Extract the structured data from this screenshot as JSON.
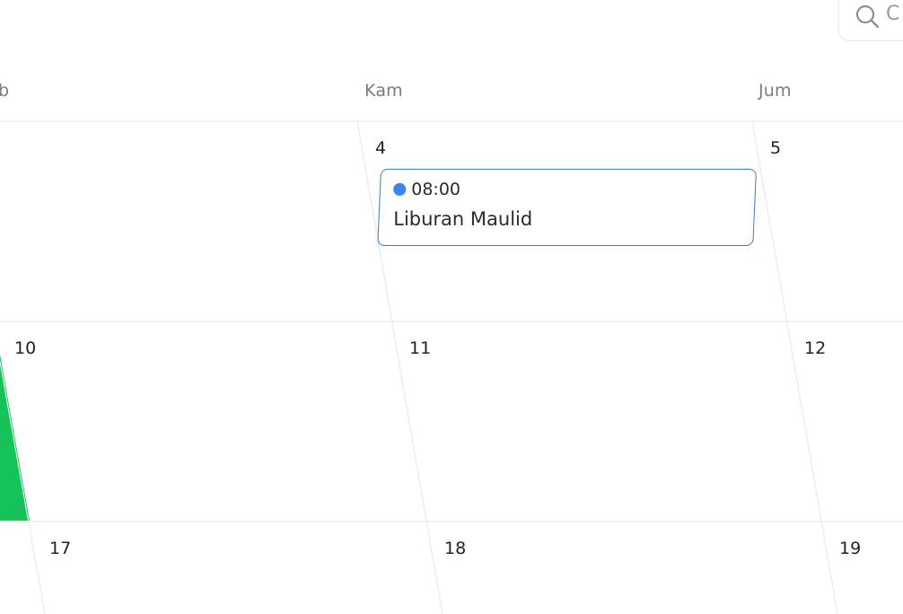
{
  "toolbar": {
    "search_prefix": "C"
  },
  "calendar": {
    "weekdays": {
      "wed": "b",
      "thu": "Kam",
      "fri": "Jum"
    },
    "days": {
      "d4": "4",
      "d5": "5",
      "d10": "10",
      "d11": "11",
      "d12": "12",
      "d17": "17",
      "d18": "18",
      "d19": "19"
    },
    "events": [
      {
        "time": "08:00",
        "title": "Liburan Maulid",
        "color": "#3b82f6",
        "border_color": "#3a7bd5"
      }
    ],
    "highlight_color": "#16c25a",
    "grid_color": "#e9e9ec"
  }
}
